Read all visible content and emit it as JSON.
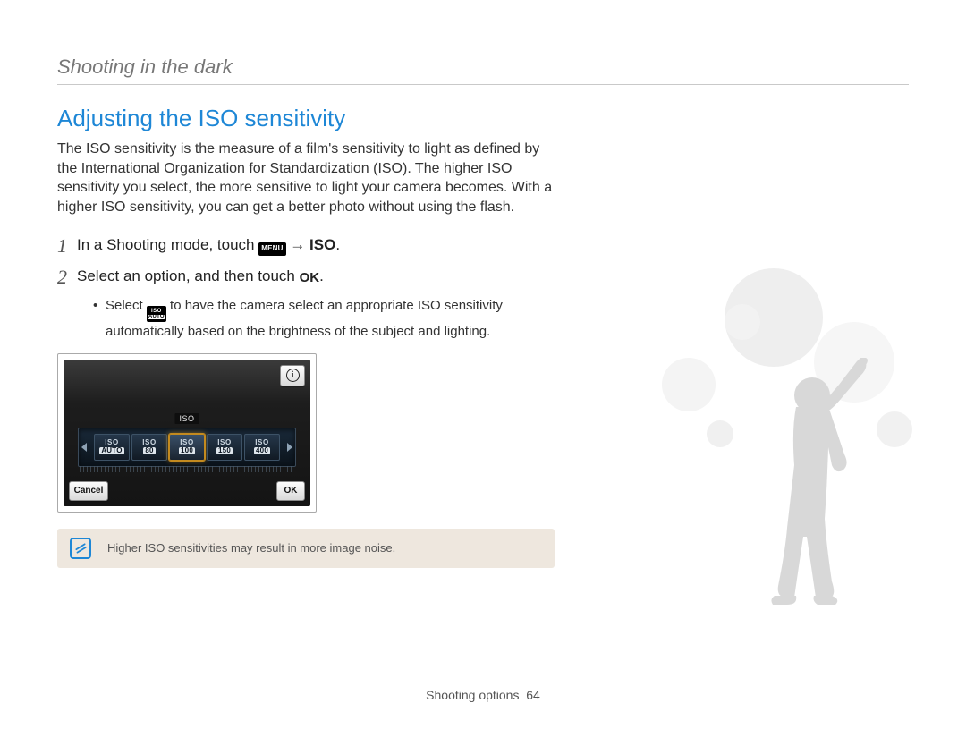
{
  "breadcrumb": "Shooting in the dark",
  "section_title": "Adjusting the ISO sensitivity",
  "intro": "The ISO sensitivity is the measure of a film's sensitivity to light as defined by the International Organization for Standardization (ISO). The higher ISO sensitivity you select, the more sensitive to light your camera becomes. With a higher ISO sensitivity, you can get a better photo without using the flash.",
  "steps": {
    "s1": {
      "num": "1",
      "pre": "In a Shooting mode, touch ",
      "menu_chip": "MENU",
      "arrow": " → ",
      "iso_suffix": "ISO",
      "period": "."
    },
    "s2": {
      "num": "2",
      "pre": "Select an option, and then touch ",
      "ok_glyph": "OK",
      "period": "."
    },
    "bullet": {
      "pre": "Select ",
      "chip_top": "ISO",
      "chip_bottom": "AUTO",
      "post": " to have the camera select an appropriate ISO sensitivity automatically based on the brightness of the subject and lighting."
    }
  },
  "lcd": {
    "info": "i",
    "cancel": "Cancel",
    "ok": "OK",
    "iso_label": "ISO",
    "options": [
      {
        "top": "ISO",
        "bottom": "AUTO"
      },
      {
        "top": "ISO",
        "bottom": "80"
      },
      {
        "top": "ISO",
        "bottom": "100"
      },
      {
        "top": "ISO",
        "bottom": "150"
      },
      {
        "top": "ISO",
        "bottom": "400"
      }
    ]
  },
  "note": "Higher ISO sensitivities may result in more image noise.",
  "footer": {
    "section": "Shooting options",
    "page": "64"
  }
}
